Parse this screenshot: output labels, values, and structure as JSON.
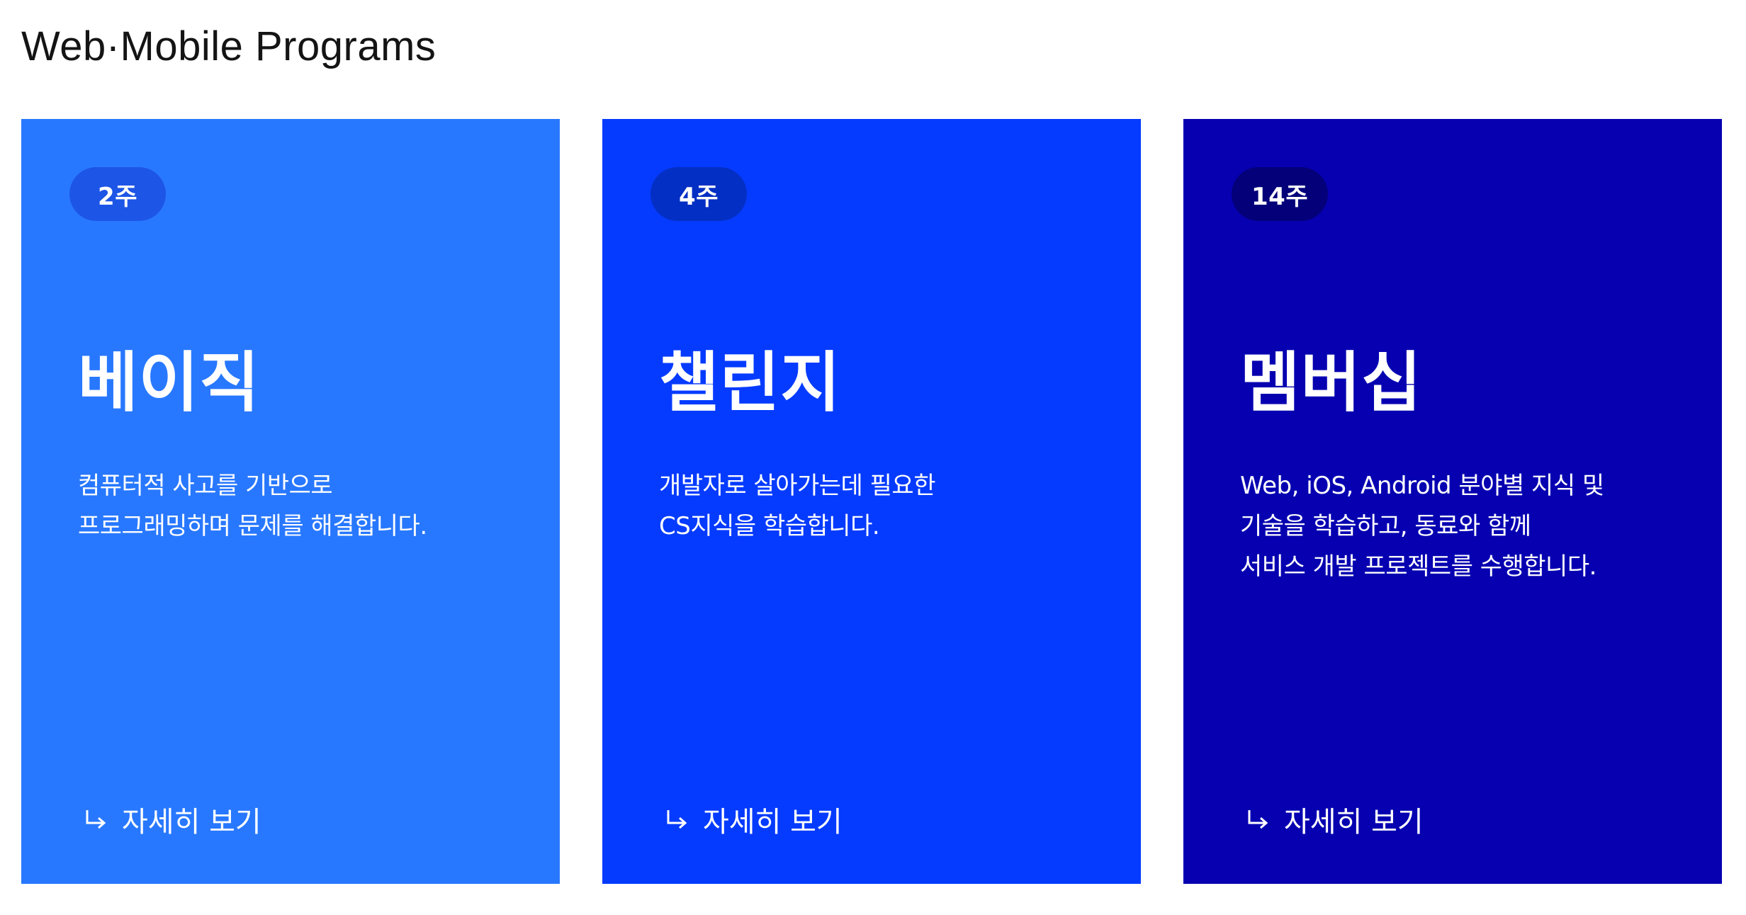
{
  "page": {
    "title": "Web·Mobile Programs"
  },
  "cards": [
    {
      "duration": "2주",
      "title": "베이직",
      "description": [
        "컴퓨터적 사고를 기반으로",
        "프로그래밍하며 문제를 해결합니다."
      ],
      "link_label": "자세히 보기",
      "background": "#2878ff"
    },
    {
      "duration": "4주",
      "title": "챌린지",
      "description": [
        "개발자로 살아가는데 필요한",
        "CS지식을 학습합니다."
      ],
      "link_label": "자세히 보기",
      "background": "#053bff"
    },
    {
      "duration": "14주",
      "title": "멤버십",
      "description": [
        "Web, iOS, Android 분야별 지식 및",
        "기술을 학습하고, 동료와 함께",
        "서비스 개발 프로젝트를 수행합니다."
      ],
      "link_label": "자세히 보기",
      "background": "#0600b0"
    }
  ],
  "icons": {
    "link_arrow": "arrow-return-right-icon"
  }
}
